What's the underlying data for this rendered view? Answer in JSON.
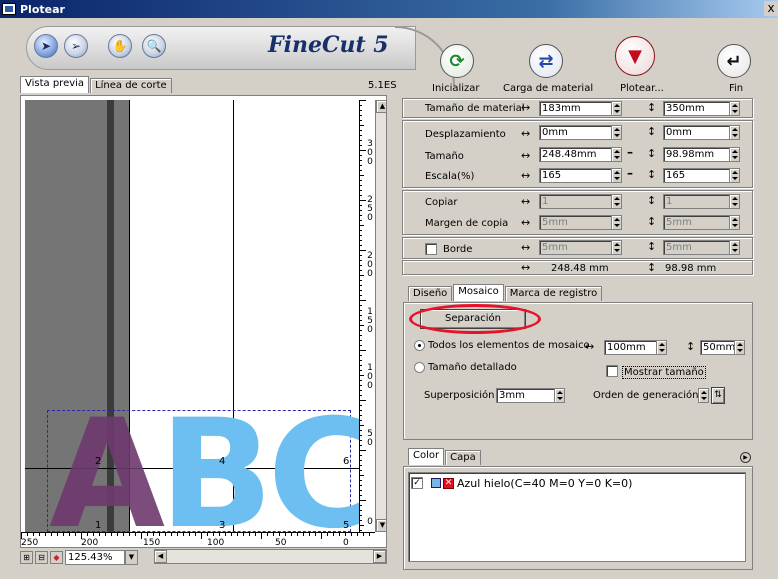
{
  "window": {
    "title": "Plotear",
    "close": "x"
  },
  "logo": "FineCut 5",
  "toolbar": {
    "tools": [
      {
        "name": "select-arrow-icon",
        "glyph": "➤"
      },
      {
        "name": "node-arrow-icon",
        "glyph": "➢"
      },
      {
        "name": "hand-icon",
        "glyph": "✋"
      },
      {
        "name": "zoom-icon",
        "glyph": "🔍"
      }
    ],
    "actions": [
      {
        "label": "Inicializar",
        "glyph": "⟳"
      },
      {
        "label": "Carga de material",
        "glyph": "⇄"
      },
      {
        "label": "Plotear...",
        "glyph": "▼"
      },
      {
        "label": "Fin",
        "glyph": "↵"
      }
    ]
  },
  "left_tabs": [
    "Vista previa",
    "Línea de corte"
  ],
  "version": "5.1ES",
  "preview": {
    "letters": "ABC",
    "tile_numbers": [
      "1",
      "2",
      "3",
      "4",
      "5",
      "6"
    ],
    "colors": {
      "gray": "#757575",
      "letter_a": "#6e3a6e",
      "letter_bc": "#6cbff0",
      "dash": "#2a2aa8"
    }
  },
  "ruler_v_labels": [
    "3\n0\n0",
    "2\n5\n0",
    "2\n0\n0",
    "1\n5\n0",
    "1\n0\n0",
    "5\n0",
    "0"
  ],
  "ruler_h_labels": [
    "250",
    "200",
    "150",
    "100",
    "50",
    "0"
  ],
  "zoom": "125.43%",
  "material": {
    "label": "Tamaño de material",
    "width": "183mm",
    "height": "350mm"
  },
  "offset": {
    "label": "Desplazamiento",
    "x": "0mm",
    "y": "0mm"
  },
  "size": {
    "label": "Tamaño",
    "x": "248.48mm",
    "y": "98.98mm"
  },
  "scale": {
    "label": "Escala(%)",
    "x": "165",
    "y": "165"
  },
  "copy": {
    "label": "Copiar",
    "x": "1",
    "y": "1"
  },
  "copy_margin": {
    "label": "Margen de copia",
    "x": "5mm",
    "y": "5mm"
  },
  "border": {
    "label": "Borde",
    "x": "5mm",
    "y": "5mm"
  },
  "result": {
    "x": "248.48 mm",
    "y": "98.98 mm"
  },
  "right_tabs": [
    "Diseño",
    "Mosaico",
    "Marca de registro"
  ],
  "mosaic": {
    "separation_button": "Separación",
    "all_elements_label": "Todos los elementos de mosaico",
    "all_x": "100mm",
    "all_y": "50mm",
    "detailed_label": "Tamaño detallado",
    "show_size_label": "Mostrar tamaño",
    "overlap_label": "Superposición",
    "overlap_value": "3mm",
    "order_label": "Orden de generación"
  },
  "color_tabs": [
    "Color",
    "Capa"
  ],
  "color_items": [
    {
      "label": "Azul hielo(C=40 M=0 Y=0 K=0)",
      "swatch": "#7ab5e0"
    }
  ]
}
